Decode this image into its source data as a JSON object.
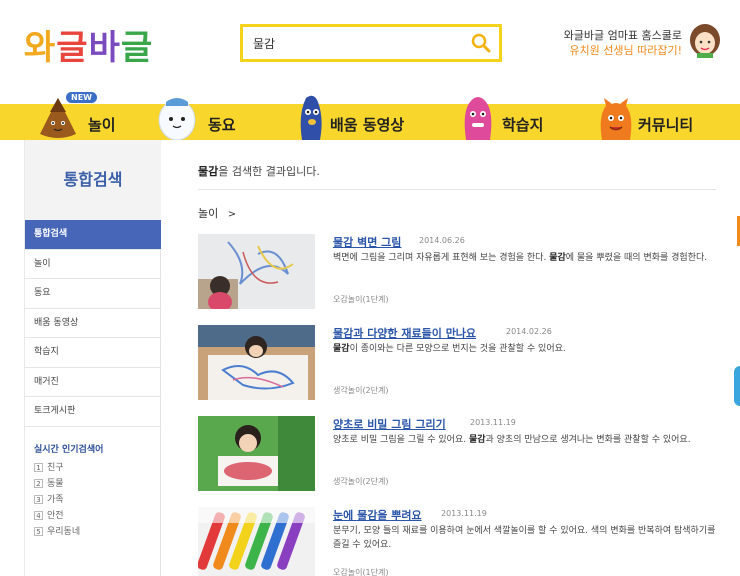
{
  "header": {
    "logo_text": "와글바글",
    "search": {
      "value": "물감",
      "placeholder": ""
    },
    "promo_line1": "와글바글 엄마표 홈스쿨로",
    "promo_line2": "유치원 선생님 따라잡기!"
  },
  "nav": {
    "new_badge": "NEW",
    "items": [
      {
        "label": "놀이"
      },
      {
        "label": "동요"
      },
      {
        "label": "배움 동영상"
      },
      {
        "label": "학습지"
      },
      {
        "label": "커뮤니티"
      }
    ]
  },
  "sidebar": {
    "title": "통합검색",
    "items": [
      {
        "label": "통합검색"
      },
      {
        "label": "놀이"
      },
      {
        "label": "동요"
      },
      {
        "label": "배움 동영상"
      },
      {
        "label": "학습지"
      },
      {
        "label": "매거진"
      },
      {
        "label": "토크게시판"
      }
    ],
    "popular_title": "실시간 인기검색어",
    "popular": [
      {
        "num": "1",
        "label": "친구"
      },
      {
        "num": "2",
        "label": "동물"
      },
      {
        "num": "3",
        "label": "가족"
      },
      {
        "num": "4",
        "label": "안전"
      },
      {
        "num": "5",
        "label": "우리동네"
      }
    ]
  },
  "main": {
    "keyword": "물감",
    "result_suffix": "을 검색한 결과입니다.",
    "category": "놀이",
    "category_arrow": ">",
    "results": [
      {
        "title": "물감 벽면 그림",
        "date": "2014.06.26",
        "desc_pre": "벽면에 그림을 그리며 자유롭게 표현해 보는 경험을 한다. ",
        "desc_kw": "물감",
        "desc_post": "에 물을 뿌렸을 때의 변화를 경험한다.",
        "tag": "오감놀이(1단계)"
      },
      {
        "title": "물감과 다양한 재료들이 만나요",
        "date": "2014.02.26",
        "desc_pre": "",
        "desc_kw": "물감",
        "desc_post": "이 종이와는 다른 모양으로 번지는 것을 관찰할 수 있어요.",
        "tag": "생각놀이(2단계)"
      },
      {
        "title": "양초로 비밀 그림 그리기",
        "date": "2013.11.19",
        "desc_pre": "양초로 비밀 그림을 그릴 수 있어요. ",
        "desc_kw": "물감",
        "desc_post": "과 양초의 만남으로 생겨나는 변화를 관찰할 수 있어요.",
        "tag": "생각놀이(2단계)"
      },
      {
        "title": "눈에 물감을 뿌려요",
        "date": "2013.11.19",
        "desc_pre": "분무기, 모양 틀의 재료를 이용하여 눈에서 색깔놀이를 할 수 있어요. 색의 변화를 반복하여 탐색하기를 즐길 수 있어요.",
        "desc_kw": "",
        "desc_post": "",
        "tag": "오감놀이(1단계)"
      }
    ]
  },
  "colors": {
    "nav_bg": "#f9d62b",
    "search_border": "#f5d21b",
    "active_side": "#4766b8",
    "title_blue": "#2a55a8"
  }
}
